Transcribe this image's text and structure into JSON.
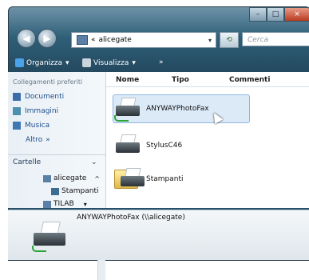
{
  "window": {
    "controls": {
      "min": "–",
      "max": "□",
      "close": "×"
    }
  },
  "address": {
    "prefix": "«",
    "value": "alicegate",
    "dropdown": "▾",
    "refresh": "⟲",
    "search_placeholder": "Cerca"
  },
  "toolbar": {
    "organizza": "Organizza",
    "visualizza": "Visualizza",
    "more": "»",
    "arrow": "▾"
  },
  "sidebar": {
    "section_title": "Collegamenti preferiti",
    "links": [
      {
        "label": "Documenti",
        "icon": "document-icon"
      },
      {
        "label": "Immagini",
        "icon": "pictures-icon"
      },
      {
        "label": "Musica",
        "icon": "music-icon"
      }
    ],
    "altro": "Altro",
    "altro_chevron": "»",
    "cartelle": "Cartelle",
    "cartelle_chevron": "⌄",
    "tree": [
      {
        "label": "alicegate",
        "arrow": "^"
      },
      {
        "label": "Stampanti"
      },
      {
        "label": "TILAB",
        "arrow": "▾"
      }
    ]
  },
  "columns": {
    "nome": "Nome",
    "tipo": "Tipo",
    "commenti": "Commenti"
  },
  "items": [
    {
      "label": "ANYWAYPhotoFax",
      "icon": "printer-icon",
      "selected": true
    },
    {
      "label": "StylusC46",
      "icon": "printer-icon",
      "selected": false
    },
    {
      "label": "Stampanti",
      "icon": "printer-folder-icon",
      "selected": false
    }
  ],
  "details": {
    "title": "ANYWAYPhotoFax (\\\\alicegate)"
  }
}
